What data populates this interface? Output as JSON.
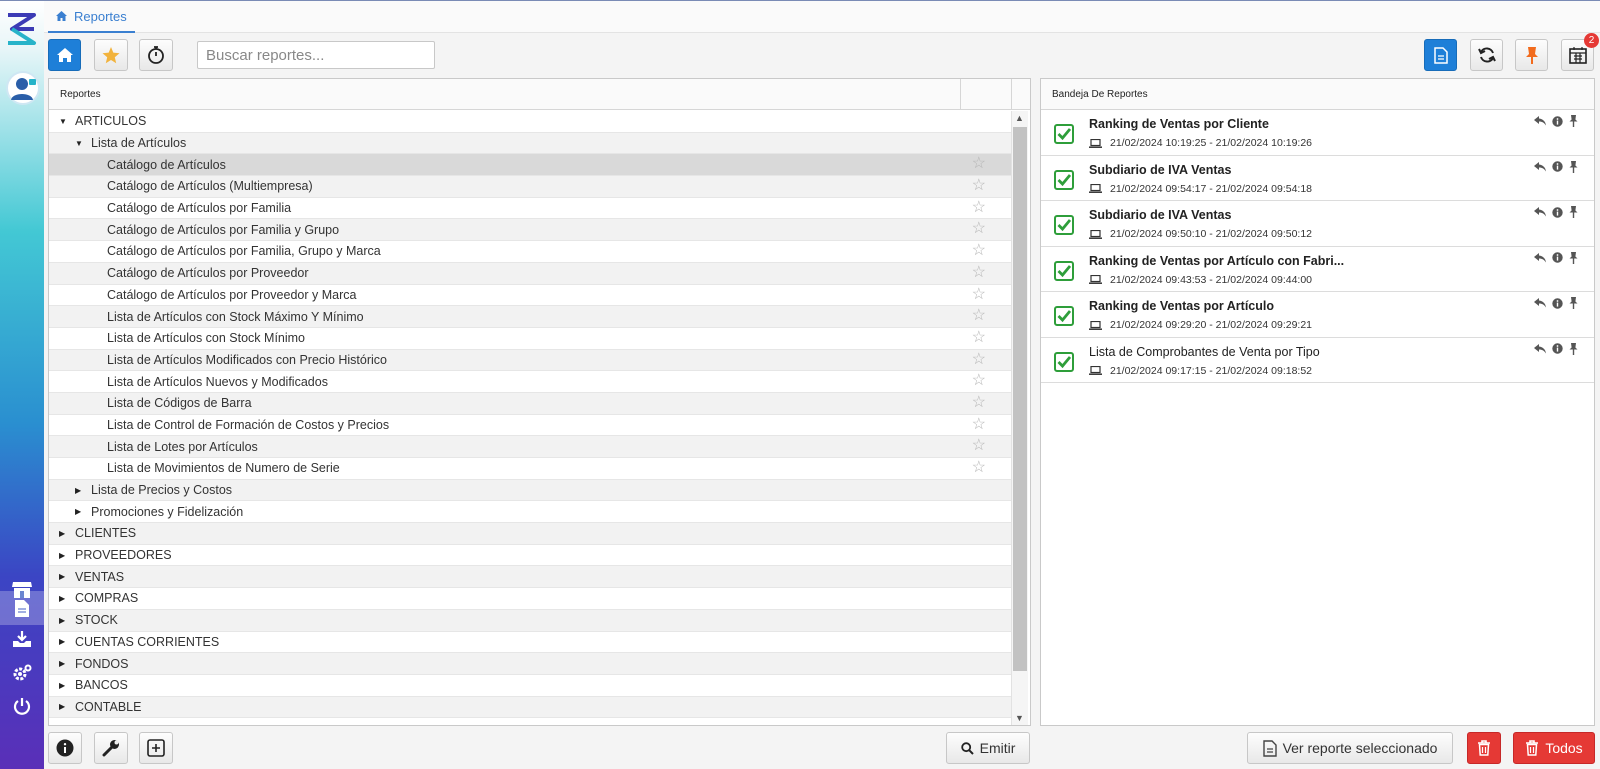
{
  "colors": {
    "accent": "#1e7fd8",
    "danger": "#e53935",
    "success": "#2e9e3a",
    "pin": "#f26b1d"
  },
  "sidebar": {
    "items": [
      {
        "icon": "store-icon"
      },
      {
        "icon": "document-icon",
        "active": true
      },
      {
        "icon": "download-icon"
      },
      {
        "icon": "gears-icon"
      },
      {
        "icon": "power-icon"
      }
    ]
  },
  "tabbar": {
    "active_tab": "Reportes"
  },
  "toolbar": {
    "search_placeholder": "Buscar reportes...",
    "calendar_badge": "2"
  },
  "reports_panel": {
    "header": "Reportes",
    "tree": [
      {
        "level": 0,
        "label": "ARTICULOS",
        "expanded": true
      },
      {
        "level": 1,
        "label": "Lista de Artículos",
        "expanded": true
      },
      {
        "level": 2,
        "label": "Catálogo de Artículos",
        "selected": true
      },
      {
        "level": 2,
        "label": "Catálogo de Artículos (Multiempresa)"
      },
      {
        "level": 2,
        "label": "Catálogo de Artículos por Familia"
      },
      {
        "level": 2,
        "label": "Catálogo de Artículos por Familia y Grupo"
      },
      {
        "level": 2,
        "label": "Catálogo de Artículos por Familia, Grupo y Marca"
      },
      {
        "level": 2,
        "label": "Catálogo de Artículos por Proveedor"
      },
      {
        "level": 2,
        "label": "Catálogo de Artículos por Proveedor y Marca"
      },
      {
        "level": 2,
        "label": "Lista de Artículos con Stock Máximo Y Mínimo"
      },
      {
        "level": 2,
        "label": "Lista de Artículos con Stock Mínimo"
      },
      {
        "level": 2,
        "label": "Lista de Artículos Modificados con Precio Histórico"
      },
      {
        "level": 2,
        "label": "Lista de Artículos Nuevos y Modificados"
      },
      {
        "level": 2,
        "label": "Lista de Códigos de Barra"
      },
      {
        "level": 2,
        "label": "Lista de Control de Formación de Costos y Precios"
      },
      {
        "level": 2,
        "label": "Lista de Lotes por Artículos"
      },
      {
        "level": 2,
        "label": "Lista de Movimientos de Numero de Serie"
      },
      {
        "level": 1,
        "label": "Lista de Precios y Costos",
        "expanded": false
      },
      {
        "level": 1,
        "label": "Promociones y Fidelización",
        "expanded": false
      },
      {
        "level": 0,
        "label": "CLIENTES",
        "expanded": false
      },
      {
        "level": 0,
        "label": "PROVEEDORES",
        "expanded": false
      },
      {
        "level": 0,
        "label": "VENTAS",
        "expanded": false
      },
      {
        "level": 0,
        "label": "COMPRAS",
        "expanded": false
      },
      {
        "level": 0,
        "label": "STOCK",
        "expanded": false
      },
      {
        "level": 0,
        "label": "CUENTAS CORRIENTES",
        "expanded": false
      },
      {
        "level": 0,
        "label": "FONDOS",
        "expanded": false
      },
      {
        "level": 0,
        "label": "BANCOS",
        "expanded": false
      },
      {
        "level": 0,
        "label": "CONTABLE",
        "expanded": false
      }
    ]
  },
  "bandeja": {
    "header": "Bandeja De Reportes",
    "items": [
      {
        "title": "Ranking de Ventas por Cliente",
        "bold": true,
        "time": "21/02/2024 10:19:25 - 21/02/2024 10:19:26"
      },
      {
        "title": "Subdiario de IVA Ventas",
        "bold": true,
        "time": "21/02/2024 09:54:17 - 21/02/2024 09:54:18"
      },
      {
        "title": "Subdiario de IVA Ventas",
        "bold": true,
        "time": "21/02/2024 09:50:10 - 21/02/2024 09:50:12"
      },
      {
        "title": "Ranking de Ventas por Artículo con Fabri...",
        "bold": true,
        "time": "21/02/2024 09:43:53 - 21/02/2024 09:44:00"
      },
      {
        "title": "Ranking de Ventas por Artículo",
        "bold": true,
        "time": "21/02/2024 09:29:20 - 21/02/2024 09:29:21"
      },
      {
        "title": "Lista de Comprobantes de Venta por Tipo",
        "bold": false,
        "time": "21/02/2024 09:17:15 - 21/02/2024 09:18:52"
      }
    ]
  },
  "footer": {
    "emit_label": "Emitir",
    "view_selected_label": "Ver reporte seleccionado",
    "delete_all_label": "Todos"
  }
}
